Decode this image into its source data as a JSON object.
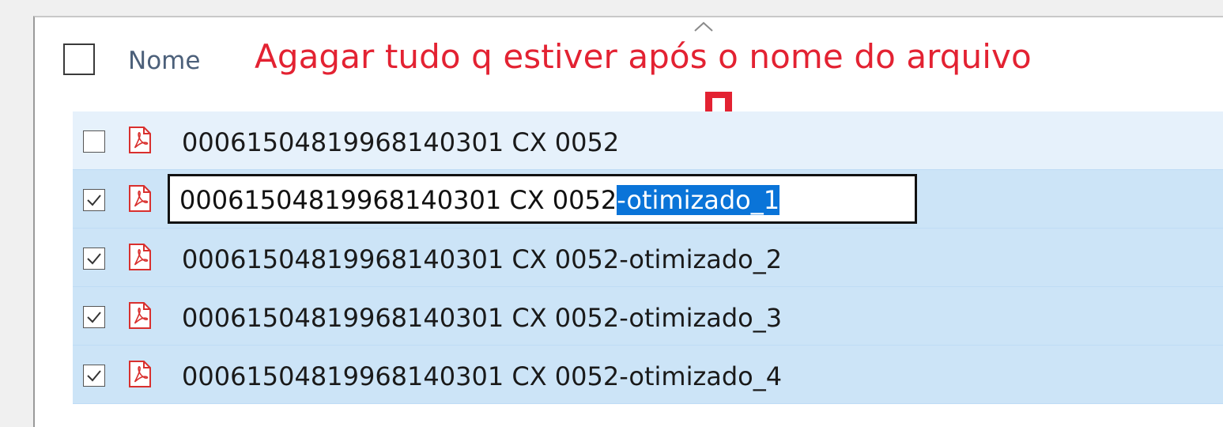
{
  "header": {
    "column_label": "Nome",
    "select_all_checked": false
  },
  "annotation": {
    "text": "Agagar tudo q estiver após o nome do arquivo",
    "color": "#e32232"
  },
  "files": [
    {
      "name": "0006150481996814030​1 CX 0052",
      "checked": false
    },
    {
      "name_base": "00061504819968140301 CX 0052",
      "name_selected": "-otimizado_1",
      "checked": true,
      "renaming": true
    },
    {
      "name": "00061504819968140301 CX 0052-otimizado_2",
      "checked": true
    },
    {
      "name": "00061504819968140301 CX 0052-otimizado_3",
      "checked": true
    },
    {
      "name": "00061504819968140301 CX 0052-otimizado_4",
      "checked": true
    }
  ],
  "colors": {
    "row_selected": "#cce4f7",
    "text_selection": "#0a74d8",
    "pdf_icon": "#d9302e"
  },
  "icons": [
    "sort-ascending-icon",
    "pdf-file-icon",
    "down-arrow-icon",
    "checkmark-icon"
  ]
}
